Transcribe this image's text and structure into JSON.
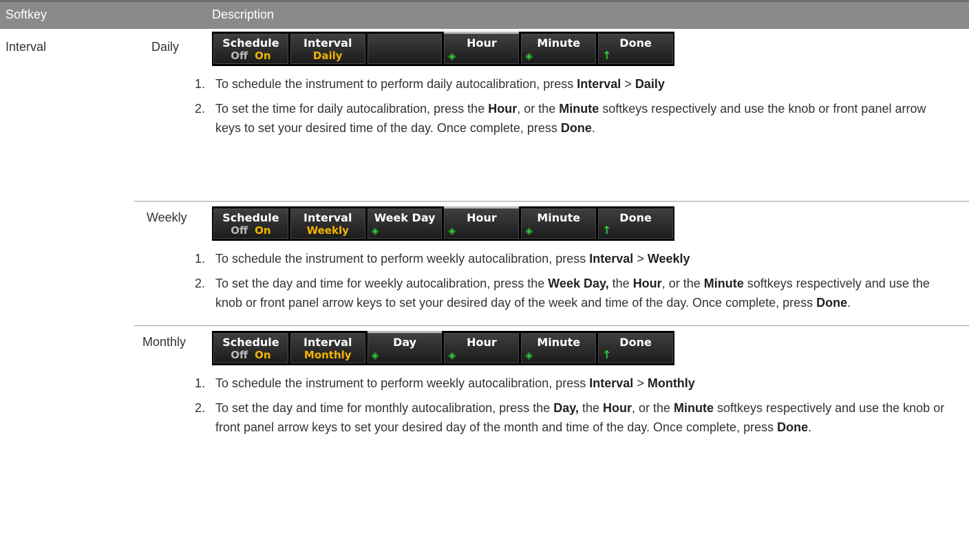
{
  "header": {
    "col_softkey": "Softkey",
    "col_description": "Description"
  },
  "row": {
    "softkey": "Interval"
  },
  "sections": [
    {
      "option": "Daily",
      "keys": [
        {
          "type": "onoff",
          "title": "Schedule",
          "off": "Off",
          "on": "On"
        },
        {
          "type": "value",
          "title": "Interval",
          "value": "Daily"
        },
        {
          "type": "blank"
        },
        {
          "type": "knob",
          "title": "Hour",
          "selected": true
        },
        {
          "type": "knob",
          "title": "Minute"
        },
        {
          "type": "arrow",
          "title": "Done"
        }
      ],
      "steps": [
        {
          "num": "1.",
          "parts": [
            "To schedule the instrument to perform daily autocalibration, press ",
            "Interval",
            " > ",
            "Daily",
            ""
          ]
        },
        {
          "num": "2.",
          "parts": [
            "To set the time for daily autocalibration, press the ",
            "Hour",
            ", or the ",
            "Minute",
            " softkeys respectively and use the knob or front panel arrow keys to set your desired time of the day. Once complete, press ",
            "Done",
            "."
          ]
        }
      ]
    },
    {
      "option": "Weekly",
      "keys": [
        {
          "type": "onoff",
          "title": "Schedule",
          "off": "Off",
          "on": "On"
        },
        {
          "type": "value",
          "title": "Interval",
          "value": "Weekly"
        },
        {
          "type": "knob",
          "title": "Week Day"
        },
        {
          "type": "knob",
          "title": "Hour",
          "selected": true
        },
        {
          "type": "knob",
          "title": "Minute"
        },
        {
          "type": "arrow",
          "title": "Done"
        }
      ],
      "steps": [
        {
          "num": "1.",
          "parts": [
            "To schedule the instrument to perform weekly autocalibration, press ",
            "Interval",
            " > ",
            "Weekly",
            ""
          ]
        },
        {
          "num": "2.",
          "parts": [
            "To set the day and time for weekly autocalibration, press the ",
            "Week Day,",
            " the ",
            "Hour",
            ", or the ",
            "Minute",
            " softkeys respectively and use the knob or front panel arrow keys to set your desired day of the week and time of the day. Once complete, press ",
            "Done",
            "."
          ]
        }
      ]
    },
    {
      "option": "Monthly",
      "keys": [
        {
          "type": "onoff",
          "title": "Schedule",
          "off": "Off",
          "on": "On"
        },
        {
          "type": "value",
          "title": "Interval",
          "value": "Monthly"
        },
        {
          "type": "knob",
          "title": "Day",
          "selected": true
        },
        {
          "type": "knob",
          "title": "Hour"
        },
        {
          "type": "knob",
          "title": "Minute"
        },
        {
          "type": "arrow",
          "title": "Done"
        }
      ],
      "steps": [
        {
          "num": "1.",
          "parts": [
            "To schedule the instrument to perform weekly autocalibration, press ",
            "Interval",
            " > ",
            "Monthly",
            ""
          ]
        },
        {
          "num": "2.",
          "parts": [
            "To set the day and time for monthly autocalibration, press the ",
            "Day,",
            " the ",
            "Hour",
            ", or the ",
            "Minute",
            " softkeys respectively and use the knob or front panel arrow keys to set your desired day of the month and time of the day. Once complete, press ",
            "Done",
            "."
          ]
        }
      ]
    }
  ]
}
